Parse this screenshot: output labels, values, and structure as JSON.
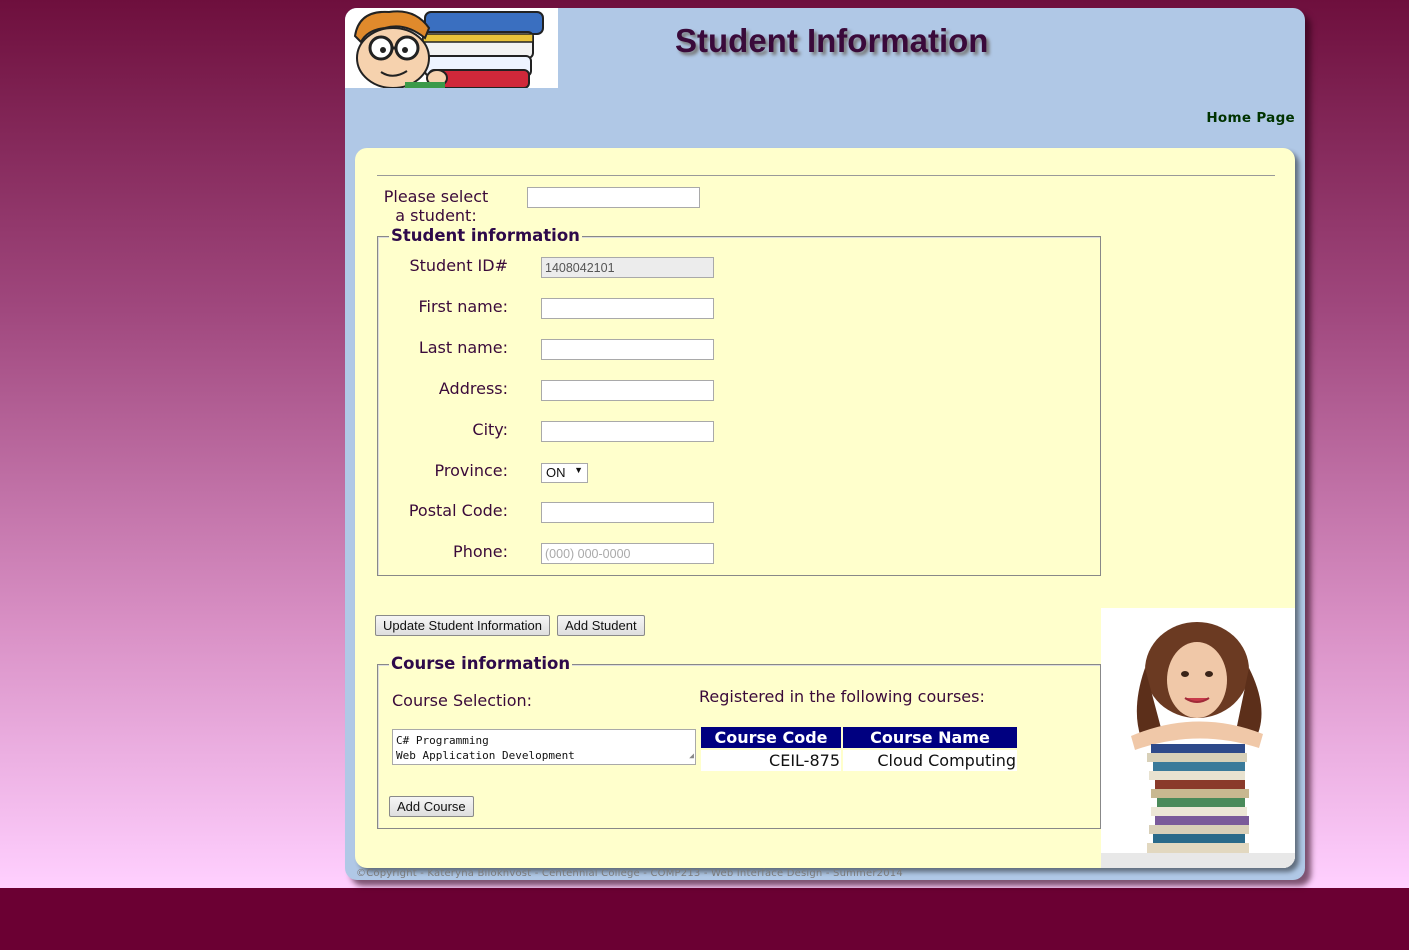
{
  "header": {
    "title": "Student Information",
    "home_link": "Home Page"
  },
  "select_student": {
    "label": "Please select a student:",
    "value": ""
  },
  "student_info": {
    "legend": "Student information",
    "fields": {
      "student_id": {
        "label": "Student ID#",
        "value": "1408042101"
      },
      "first_name": {
        "label": "First name:",
        "value": ""
      },
      "last_name": {
        "label": "Last name:",
        "value": ""
      },
      "address": {
        "label": "Address:",
        "value": ""
      },
      "city": {
        "label": "City:",
        "value": ""
      },
      "province": {
        "label": "Province:",
        "value": "ON"
      },
      "postal_code": {
        "label": "Postal Code:",
        "value": ""
      },
      "phone": {
        "label": "Phone:",
        "placeholder": "(000) 000-0000"
      }
    }
  },
  "buttons": {
    "update": "Update Student Information",
    "add_student": "Add Student",
    "add_course": "Add Course"
  },
  "course_info": {
    "legend": "Course information",
    "selection_label": "Course Selection:",
    "course_options": [
      "C# Programming",
      "Web Application Development"
    ],
    "registered_label": "Registered in the following courses:",
    "table": {
      "headers": [
        "Course Code",
        "Course Name"
      ],
      "rows": [
        [
          "CEIL-875",
          "Cloud Computing"
        ]
      ]
    }
  },
  "footer": {
    "copyright": "©Copyright - Kateryna Bilokhvost - Centennial College - COMP213 - Web Interface Design - Summer2014"
  },
  "colors": {
    "header_bg": "#b0c8e6",
    "content_bg": "#ffffcc",
    "table_header": "#000080",
    "page_bg": "#6b0033"
  }
}
